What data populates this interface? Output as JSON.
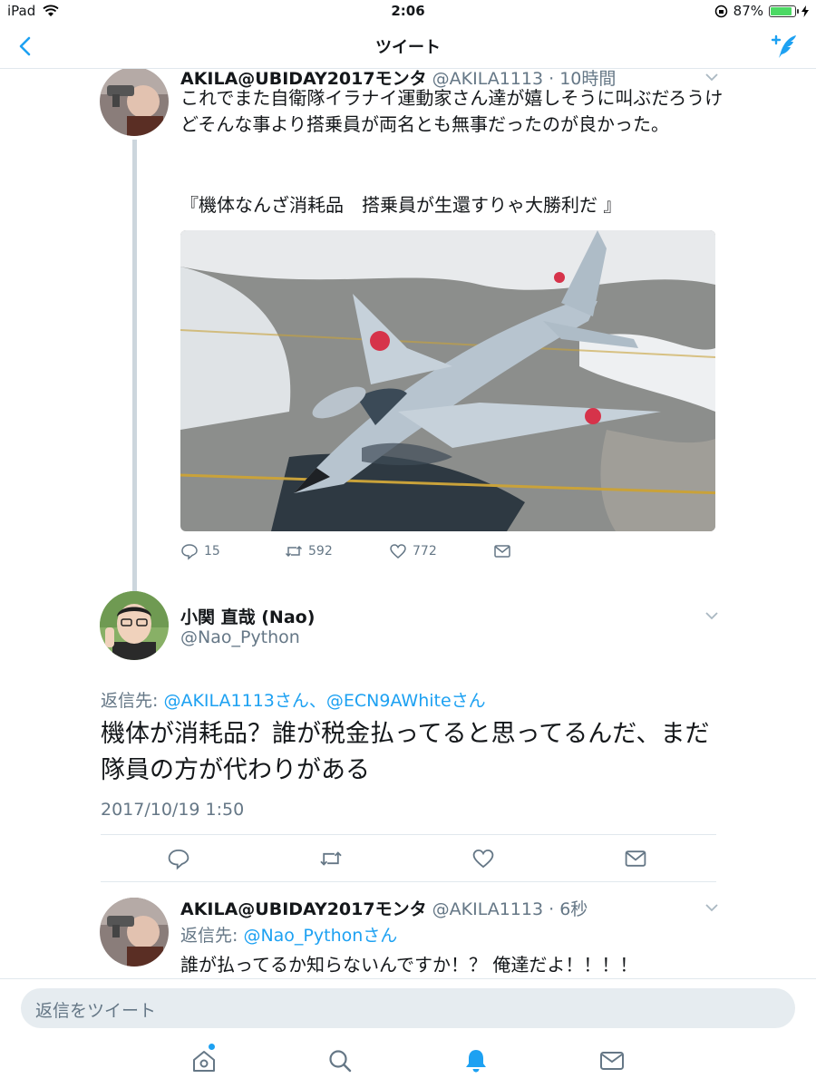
{
  "status_bar": {
    "device": "iPad",
    "time": "2:06",
    "battery": "87%",
    "battery_level": 0.87
  },
  "nav": {
    "title": "ツイート"
  },
  "tweet1": {
    "name": "AKILA@UBIDAY2017モンタ",
    "handle": "@AKILA1113",
    "time": "10時間",
    "text": "これでまた自衛隊イラナイ運動家さん達が嬉しそうに叫ぶだろうけどそんな事より搭乗員が両名とも無事だったのが良かった。",
    "quote": "『機体なんざ消耗品　搭乗員が生還すりゃ大勝利だ 』",
    "replies": "15",
    "retweets": "592",
    "likes": "772"
  },
  "tweet2": {
    "name": "小関 直哉 (Nao)",
    "handle": "@Nao_Python",
    "reply_label": "返信先:",
    "reply_targets": "@AKILA1113さん、@ECN9AWhiteさん",
    "body": "機体が消耗品？誰が税金払ってると思ってるんだ、まだ隊員の方が代わりがある",
    "timestamp": "2017/10/19 1:50"
  },
  "tweet3": {
    "name": "AKILA@UBIDAY2017モンタ",
    "handle": "@AKILA1113",
    "time": "6秒",
    "reply_label": "返信先:",
    "reply_target": "@Nao_Pythonさん",
    "text": "誰が払ってるか知らないんですか！？ 俺達だよ！！！！"
  },
  "reply_bar": {
    "placeholder": "返信をツイート"
  },
  "colors": {
    "accent": "#1da1f2",
    "muted": "#657786",
    "text": "#14171a",
    "border": "#e1e8ed"
  }
}
